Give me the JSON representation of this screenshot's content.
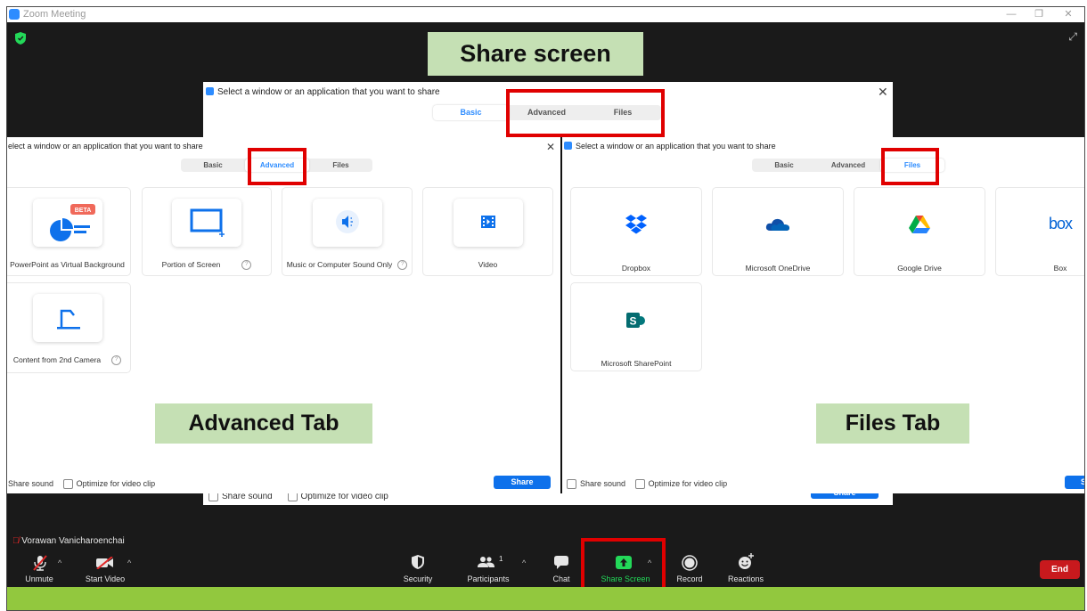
{
  "window": {
    "title": "Zoom Meeting",
    "min": "—",
    "restore": "❐",
    "close": "✕"
  },
  "callouts": {
    "top": "Share screen",
    "advanced": "Advanced Tab",
    "files": "Files Tab"
  },
  "back_dialog": {
    "title": "Select a window or an application that you want to share",
    "tabs": [
      "Basic",
      "Advanced",
      "Files"
    ],
    "footer": {
      "share_sound": "Share sound",
      "optimize": "Optimize for video clip",
      "share": "Share"
    }
  },
  "advanced_dialog": {
    "title": "elect a window or an application that you want to share",
    "tabs": [
      "Basic",
      "Advanced",
      "Files"
    ],
    "active_tab": "Advanced",
    "beta_badge": "BETA",
    "items": [
      {
        "label": "PowerPoint as Virtual Background",
        "icon": "powerpoint-icon",
        "help": false
      },
      {
        "label": "Portion of Screen",
        "icon": "screen-portion-icon",
        "help": true
      },
      {
        "label": "Music or Computer Sound Only",
        "icon": "speaker-icon",
        "help": true
      },
      {
        "label": "Video",
        "icon": "film-icon",
        "help": false
      },
      {
        "label": "Content from 2nd Camera",
        "icon": "document-camera-icon",
        "help": true
      }
    ],
    "help_glyph": "?",
    "footer": {
      "share_sound": "Share sound",
      "optimize": "Optimize for video clip",
      "share": "Share"
    }
  },
  "files_dialog": {
    "title": "Select a window or an application that you want to share",
    "tabs": [
      "Basic",
      "Advanced",
      "Files"
    ],
    "active_tab": "Files",
    "items": [
      {
        "label": "Dropbox",
        "icon": "dropbox-icon"
      },
      {
        "label": "Microsoft OneDrive",
        "icon": "onedrive-icon"
      },
      {
        "label": "Google Drive",
        "icon": "google-drive-icon"
      },
      {
        "label": "Box",
        "icon": "box-icon",
        "logo_text": "box"
      },
      {
        "label": "Microsoft SharePoint",
        "icon": "sharepoint-icon",
        "logo_text": "S"
      }
    ],
    "footer": {
      "share_sound": "Share sound",
      "optimize": "Optimize for video clip",
      "share": "S"
    }
  },
  "participant_name": "Vorawan Vanicharoenchai",
  "toolbar": {
    "unmute": "Unmute",
    "start_video": "Start Video",
    "security": "Security",
    "participants": "Participants",
    "participants_count": "1",
    "chat": "Chat",
    "share_screen": "Share Screen",
    "record": "Record",
    "reactions": "Reactions",
    "end": "End"
  },
  "colors": {
    "accent": "#2d8cff",
    "share_green": "#23d959",
    "end_red": "#c8191d",
    "callout": "#c5e0b4",
    "highlight": "#e00000",
    "bottom_bar": "#92c83e"
  }
}
